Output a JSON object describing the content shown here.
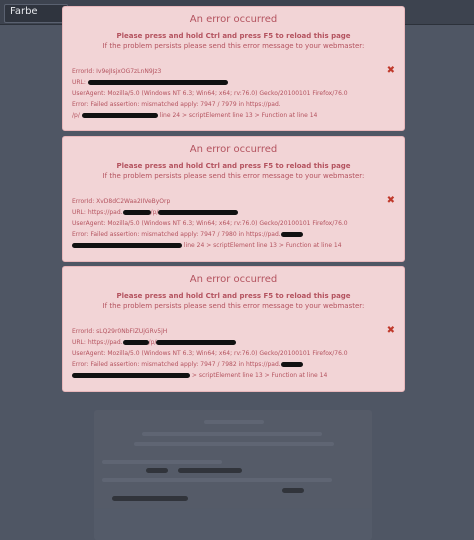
{
  "topbar": {
    "label": "Farbe"
  },
  "errors": [
    {
      "title": "An error occurred",
      "line1": "Please press and hold Ctrl and press F5 to reload this page",
      "line2": "If the problem persists please send this error message to your webmaster:",
      "error_id": "ErrorId: Iv9eJIsjxOG7zLnN9Jz3",
      "url_label": "URL:",
      "user_agent": "UserAgent: Mozilla/5.0 (Windows NT 6.3; Win64; x64; rv:76.0) Gecko/20100101 Firefox/76.0",
      "error_prefix": "Error: Failed assertion: mismatched apply: 7947 / 7979 in https://pad.",
      "error_suffix_start": "/p/",
      "error_suffix_end": "line 24 > scriptElement line 13 > Function at line 14",
      "close_symbol": "✖"
    },
    {
      "title": "An error occurred",
      "line1": "Please press and hold Ctrl and press F5 to reload this page",
      "line2": "If the problem persists please send this error message to your webmaster:",
      "error_id": "ErrorId: XvD8dC2Waa2IIVeByOrp",
      "url_label": "URL: https://pad.",
      "url_mid": "/p/",
      "user_agent_prefix": "UserAgent: Mozilla/5.0 (Windows NT 6.3; Win64; x64; rv:76.0) Gecko/20100101 Firefox/76.0",
      "error_prefix": "Error: Failed assertion: mismatched apply: 7947 / 7980 in https://pad.",
      "error_suffix_end": "line 24 > scriptElement line 13 > Function at line 14",
      "close_symbol": "✖"
    },
    {
      "title": "An error occurred",
      "line1": "Please press and hold Ctrl and press F5 to reload this page",
      "line2": "If the problem persists please send this error message to your webmaster:",
      "error_id": "ErrorId: sLQ29r0NbFIZUjGRv5jH",
      "url_label": "URL: https://pad.",
      "url_mid": "/p/",
      "user_agent": "UserAgent: Mozilla/5.0 (Windows NT 6.3; Win64; x64; rv:76.0) Gecko/20100101 Firefox/76.0",
      "error_prefix": "Error: Failed assertion: mismatched apply: 7947 / 7982 in https://pad.",
      "error_suffix_end": "> scriptElement line 13 > Function at line 14",
      "close_symbol": "✖"
    }
  ]
}
